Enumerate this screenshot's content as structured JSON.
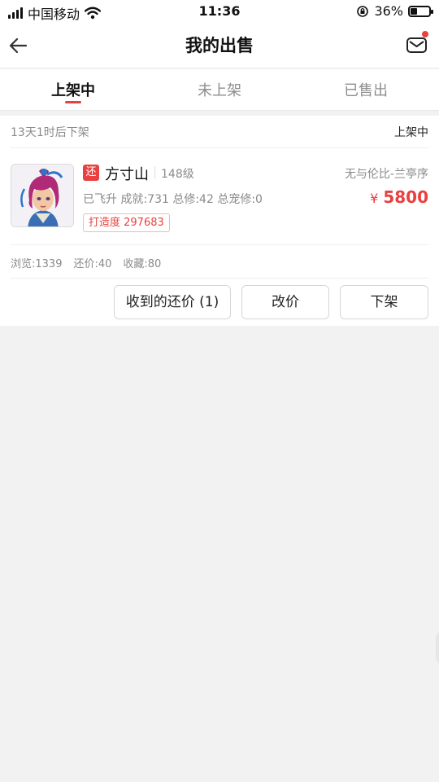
{
  "status_bar": {
    "carrier": "中国移动",
    "time": "11:36",
    "battery_percent": "36%",
    "battery_level": 0.36,
    "icons": [
      "signal-icon",
      "wifi-icon",
      "rotation-lock-icon",
      "battery-icon"
    ]
  },
  "nav": {
    "title": "我的出售",
    "back_icon": "arrow-left-icon",
    "mail_icon": "mail-icon",
    "has_unread": true
  },
  "tabs": [
    {
      "label": "上架中",
      "active": true
    },
    {
      "label": "未上架",
      "active": false
    },
    {
      "label": "已售出",
      "active": false
    }
  ],
  "listing": {
    "countdown": "13天1时后下架",
    "status": "上架中",
    "badge": "还",
    "name": "方寸山",
    "level": "148级",
    "server": "无与伦比-兰亭序",
    "attributes": "已飞升 成就:731 总修:42 总宠修:0",
    "price_symbol": "¥",
    "price": "5800",
    "forge": "打造度 297683",
    "stats": {
      "views": "浏览:1339",
      "offers": "还价:40",
      "favorites": "收藏:80"
    },
    "buttons": {
      "offers": "收到的还价 (1)",
      "edit_price": "改价",
      "delist": "下架"
    }
  },
  "colors": {
    "accent": "#e8413f",
    "text_primary": "#222222",
    "text_secondary": "#8a8a8a",
    "background": "#f2f2f2"
  }
}
